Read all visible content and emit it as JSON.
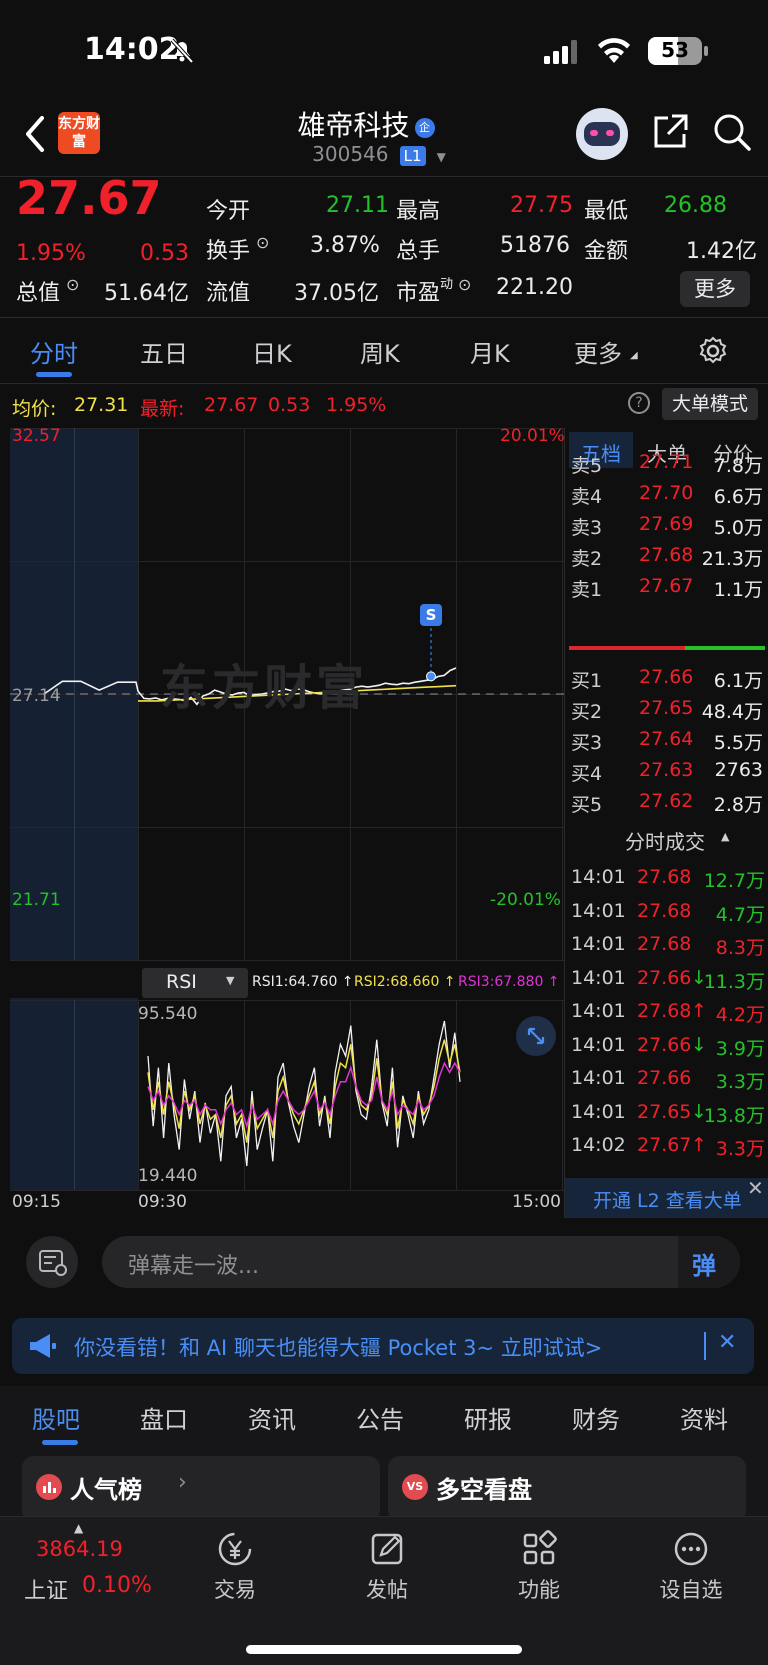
{
  "status_bar": {
    "time": "14:02",
    "battery": "53"
  },
  "header": {
    "logo_text": "东方财富",
    "stock_name": "雄帝科技",
    "stock_code": "300546",
    "level_badge": "L1",
    "company_badge": "企"
  },
  "quote": {
    "price": "27.67",
    "change_pct": "1.95%",
    "change": "0.53",
    "fields": [
      {
        "label": "今开",
        "value": "27.11",
        "color": "#25c02a"
      },
      {
        "label": "最高",
        "value": "27.75",
        "color": "#f0212b"
      },
      {
        "label": "最低",
        "value": "26.88",
        "color": "#25c02a"
      },
      {
        "label": "换手",
        "value": "3.87%",
        "color": "#ececec"
      },
      {
        "label": "总手",
        "value": "51876",
        "color": "#ececec"
      },
      {
        "label": "金额",
        "value": "1.42亿",
        "color": "#ececec"
      },
      {
        "label": "总值",
        "value": "51.64亿",
        "color": "#ececec"
      },
      {
        "label": "流值",
        "value": "37.05亿",
        "color": "#ececec"
      },
      {
        "label": "市盈",
        "label_sup": "动",
        "value": "221.20",
        "color": "#ececec"
      }
    ],
    "more_button": "更多"
  },
  "chart_tabs": [
    "分时",
    "五日",
    "日K",
    "周K",
    "月K",
    "更多"
  ],
  "info_line": {
    "avg_label": "均价:",
    "avg_value": "27.31",
    "latest_label": "最新:",
    "latest_value": "27.67",
    "latest_change": "0.53",
    "latest_pct": "1.95%",
    "mode_button": "大单模式"
  },
  "chart_data": {
    "type": "line",
    "title": "",
    "y_axis_left": {
      "max_label": "32.57",
      "mid_label": "27.14",
      "min_label": "21.71"
    },
    "y_axis_right": {
      "max_label": "20.01%",
      "min_label": "-20.01%"
    },
    "ylim": [
      21.71,
      32.57
    ],
    "prev_close": 27.14,
    "x_tick_labels": [
      "09:15",
      "09:30",
      "15:00"
    ],
    "watermark": "东方财富",
    "signal_marker": "S",
    "series": [
      {
        "values": [
          27.14,
          27.4,
          27.4,
          27.22,
          27.38,
          27.38,
          27.2,
          27.05,
          27.04,
          27.06,
          27.02,
          27.05,
          27.04,
          27.03,
          27.0,
          27.07,
          26.93,
          27.1,
          27.14,
          27.22,
          27.18,
          27.14,
          27.12,
          27.16,
          27.17,
          27.1,
          27.13,
          27.14,
          27.16,
          27.19,
          27.2,
          27.24,
          27.21,
          27.24,
          27.23,
          27.19,
          27.16,
          27.14,
          27.16,
          27.18,
          27.2,
          27.22,
          27.24,
          27.28,
          27.3,
          27.28,
          27.3,
          27.32,
          27.36,
          27.34,
          27.33,
          27.36,
          27.35,
          27.38,
          27.4,
          27.42,
          27.44,
          27.5,
          27.52,
          27.62,
          27.67
        ]
      },
      {
        "values": [
          27.0,
          27.0,
          27.0,
          27.01,
          27.02,
          27.03,
          27.04,
          27.05,
          27.06,
          27.07,
          27.08,
          27.09,
          27.1,
          27.11,
          27.12,
          27.13,
          27.14,
          27.15,
          27.16,
          27.17,
          27.18,
          27.19,
          27.2,
          27.21,
          27.22,
          27.23,
          27.24,
          27.25,
          27.26,
          27.27,
          27.28,
          27.29,
          27.3,
          27.31
        ]
      }
    ],
    "rsi": {
      "indicator": "RSI",
      "labels": [
        {
          "text": "RSI1:64.760 ↑",
          "color": "#ececec"
        },
        {
          "text": "RSI2:68.660 ↑",
          "color": "#f0e14a"
        },
        {
          "text": "RSI3:67.880 ↑",
          "color": "#e033d6"
        }
      ],
      "max_label": "95.540",
      "min_label": "19.440",
      "ylim": [
        19.44,
        95.54
      ],
      "series": [
        {
          "values": [
            75,
            45,
            70,
            40,
            72,
            50,
            35,
            65,
            48,
            60,
            38,
            55,
            42,
            50,
            30,
            58,
            62,
            40,
            48,
            28,
            60,
            35,
            44,
            52,
            30,
            66,
            72,
            55,
            45,
            38,
            50,
            62,
            70,
            45,
            58,
            40,
            68,
            80,
            75,
            88,
            60,
            50,
            48,
            62,
            82,
            55,
            45,
            70,
            36,
            58,
            50,
            40,
            60,
            46,
            52,
            66,
            80,
            90,
            70,
            85,
            64
          ]
        },
        {
          "values": [
            68,
            52,
            64,
            50,
            64,
            54,
            44,
            60,
            52,
            58,
            46,
            54,
            48,
            50,
            40,
            54,
            58,
            46,
            50,
            38,
            56,
            44,
            48,
            52,
            40,
            60,
            66,
            56,
            50,
            46,
            52,
            58,
            64,
            50,
            56,
            46,
            62,
            72,
            70,
            80,
            62,
            54,
            52,
            58,
            74,
            56,
            50,
            64,
            44,
            56,
            52,
            46,
            58,
            50,
            54,
            62,
            74,
            82,
            72,
            80,
            68
          ]
        },
        {
          "values": [
            62,
            56,
            60,
            54,
            58,
            55,
            50,
            56,
            54,
            56,
            50,
            54,
            52,
            52,
            46,
            52,
            55,
            50,
            52,
            45,
            54,
            48,
            50,
            52,
            46,
            56,
            60,
            56,
            52,
            50,
            52,
            56,
            60,
            52,
            55,
            50,
            58,
            64,
            64,
            70,
            62,
            56,
            54,
            56,
            66,
            56,
            52,
            60,
            50,
            54,
            52,
            50,
            56,
            52,
            54,
            58,
            66,
            72,
            68,
            72,
            68
          ]
        }
      ]
    }
  },
  "order_book": {
    "tabs": [
      "五档",
      "大单",
      "分价"
    ],
    "asks": [
      {
        "label": "卖5",
        "price": "27.71",
        "vol": "7.8万"
      },
      {
        "label": "卖4",
        "price": "27.70",
        "vol": "6.6万"
      },
      {
        "label": "卖3",
        "price": "27.69",
        "vol": "5.0万"
      },
      {
        "label": "卖2",
        "price": "27.68",
        "vol": "21.3万"
      },
      {
        "label": "卖1",
        "price": "27.67",
        "vol": "1.1万"
      }
    ],
    "bids": [
      {
        "label": "买1",
        "price": "27.66",
        "vol": "6.1万"
      },
      {
        "label": "买2",
        "price": "27.65",
        "vol": "48.4万"
      },
      {
        "label": "买3",
        "price": "27.64",
        "vol": "5.5万"
      },
      {
        "label": "买4",
        "price": "27.63",
        "vol": "2763"
      },
      {
        "label": "买5",
        "price": "27.62",
        "vol": "2.8万"
      }
    ],
    "trades_title": "分时成交",
    "trades": [
      {
        "time": "14:01",
        "price": "27.68",
        "arrow": "",
        "vol": "12.7万",
        "vol_color": "#25c02a"
      },
      {
        "time": "14:01",
        "price": "27.68",
        "arrow": "",
        "vol": "4.7万",
        "vol_color": "#25c02a"
      },
      {
        "time": "14:01",
        "price": "27.68",
        "arrow": "",
        "vol": "8.3万",
        "vol_color": "#f0212b"
      },
      {
        "time": "14:01",
        "price": "27.66",
        "arrow": "↓",
        "vol": "11.3万",
        "vol_color": "#25c02a"
      },
      {
        "time": "14:01",
        "price": "27.68",
        "arrow": "↑",
        "vol": "4.2万",
        "vol_color": "#f0212b"
      },
      {
        "time": "14:01",
        "price": "27.66",
        "arrow": "↓",
        "vol": "3.9万",
        "vol_color": "#25c02a"
      },
      {
        "time": "14:01",
        "price": "27.66",
        "arrow": "",
        "vol": "3.3万",
        "vol_color": "#25c02a"
      },
      {
        "time": "14:01",
        "price": "27.65",
        "arrow": "↓",
        "vol": "13.8万",
        "vol_color": "#25c02a"
      },
      {
        "time": "14:02",
        "price": "27.67",
        "arrow": "↑",
        "vol": "3.3万",
        "vol_color": "#f0212b"
      }
    ],
    "l2_banner": "开通 L2 查看大单"
  },
  "danmu": {
    "placeholder": "弹幕走一波...",
    "send_label": "弹"
  },
  "ad": {
    "text": "你没看错！和 AI 聊天也能得大疆 Pocket 3~ 立即试试>"
  },
  "bottom_tabs": [
    "股吧",
    "盘口",
    "资讯",
    "公告",
    "研报",
    "财务",
    "资料"
  ],
  "cards": [
    {
      "label": "人气榜"
    },
    {
      "label": "多空看盘"
    }
  ],
  "dock": {
    "index_value": "3864.19",
    "index_name": "上证",
    "index_pct": "0.10%",
    "items": [
      {
        "label": "交易"
      },
      {
        "label": "发帖"
      },
      {
        "label": "功能"
      },
      {
        "label": "设自选"
      }
    ]
  }
}
